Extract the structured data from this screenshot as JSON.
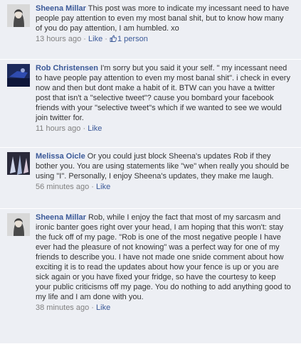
{
  "comments": [
    {
      "author": "Sheena Millar",
      "text": "This post was more to indicate my incessant need to have people pay attention to even my most banal shit, but to know how many of you do pay attention, I am humbled. xo",
      "time": "13 hours ago",
      "sep": "·",
      "like_label": "Like",
      "sep2": "·",
      "likes_count": "1 person",
      "avatar_icon": "profile-photo-icon"
    },
    {
      "author": "Rob Christensen",
      "text": "I'm sorry but you said it your self. \" my incessant need to have people pay attention to even my most banal shit\". i check in every now and then but dont make a habit of it. BTW can you have a twitter post that isn't a \"selective tweet\"? cause you bombard your facebook friends with your \"selective tweet\"s which if we wanted to see we would join twitter for.",
      "time": "11 hours ago",
      "sep": "·",
      "like_label": "Like",
      "avatar_icon": "profile-photo-icon"
    },
    {
      "author": "Melissa Oicle",
      "text": "Or you could just block Sheena's updates Rob if they bother you. You are using statements like \"we\" when really you should be using \"I\". Personally, I enjoy Sheena's updates, they make me laugh.",
      "time": "56 minutes ago",
      "sep": "·",
      "like_label": "Like",
      "avatar_icon": "profile-photo-icon"
    },
    {
      "author": "Sheena Millar",
      "text": "Rob, while I enjoy the fact that most of my sarcasm and ironic banter goes right over your head, I am hoping that this won't: stay the fuck off of my page. \"Rob is one of the most negative people I have ever had the pleasure of not knowing\" was a perfect way for one of my friends to describe you. I have not made one snide comment about how exciting it is to read the updates about how your fence is up or you are sick again or you have fixed your fridge, so have the courtesy to keep your public criticisms off my page. You do nothing to add anything good to my life and I am done with you.",
      "time": "38 minutes ago",
      "sep": "·",
      "like_label": "Like",
      "avatar_icon": "profile-photo-icon"
    }
  ],
  "colors": {
    "link": "#3b5998",
    "background": "#edeff4",
    "meta": "#808080",
    "text": "#333333"
  },
  "like_icon": "thumbs-up-icon"
}
